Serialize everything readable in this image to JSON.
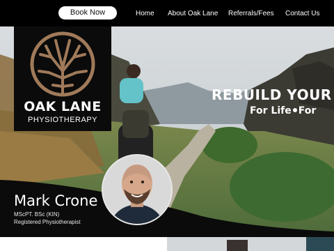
{
  "header": {
    "book_label": "Book Now",
    "nav": [
      "Home",
      "About Oak Lane",
      "Referrals/Fees",
      "Contact Us"
    ]
  },
  "logo": {
    "name": "OAK LANE",
    "subtitle": "PHYSIOTHERAPY",
    "tree_color": "#a07a5a"
  },
  "hero": {
    "headline": "REBUILD YOUR",
    "subheadline_left": "For Life",
    "subheadline_right": "For"
  },
  "profile": {
    "name": "Mark Crone",
    "credentials": "MScPT. BSc (KIN)",
    "title": "Registered Physiotherapist"
  }
}
